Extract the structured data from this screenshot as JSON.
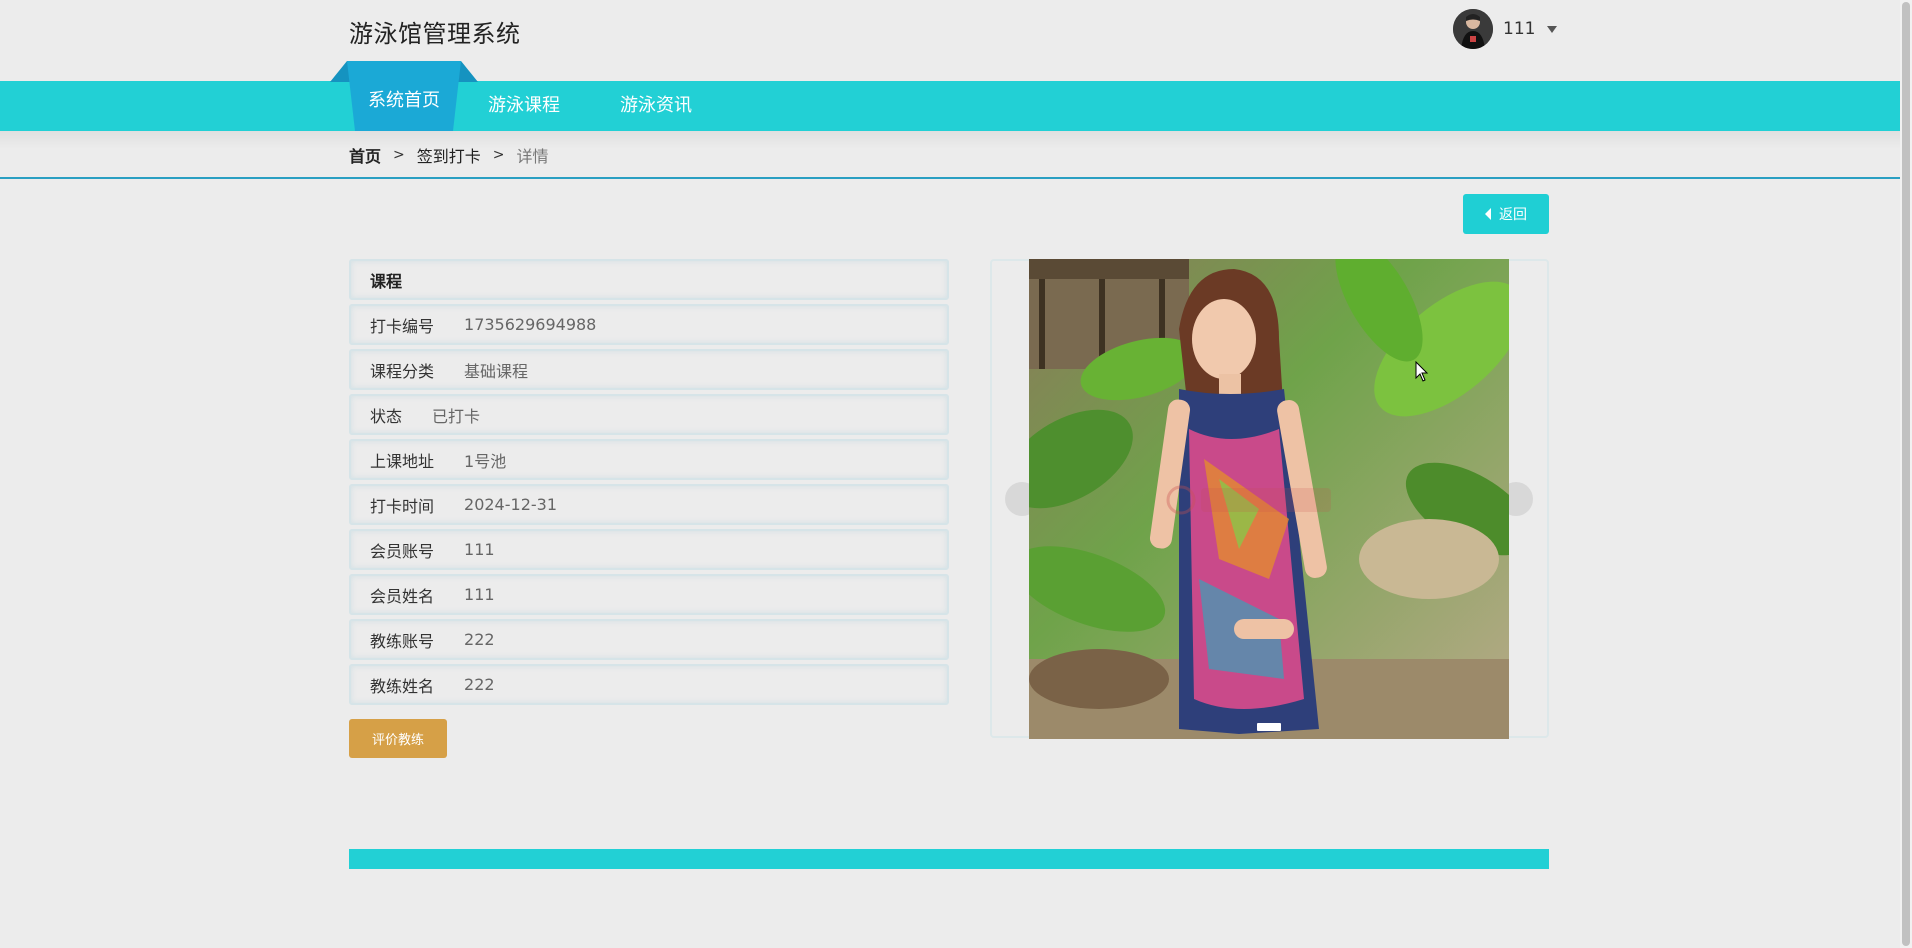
{
  "header": {
    "site_title": "游泳馆管理系统",
    "username": "111"
  },
  "nav": {
    "items": [
      {
        "label": "系统首页",
        "active": true
      },
      {
        "label": "游泳课程",
        "active": false
      },
      {
        "label": "游泳资讯",
        "active": false
      }
    ]
  },
  "breadcrumb": {
    "home": "首页",
    "section": "签到打卡",
    "current": "详情",
    "separator": ">"
  },
  "back_button": {
    "label": "返回"
  },
  "detail": {
    "title": "课程",
    "rows": [
      {
        "label": "打卡编号",
        "value": "1735629694988"
      },
      {
        "label": "课程分类",
        "value": "基础课程"
      },
      {
        "label": "状态",
        "value": "已打卡"
      },
      {
        "label": "上课地址",
        "value": "1号池"
      },
      {
        "label": "打卡时间",
        "value": "2024-12-31"
      },
      {
        "label": "会员账号",
        "value": "111"
      },
      {
        "label": "会员姓名",
        "value": "111"
      },
      {
        "label": "教练账号",
        "value": "222"
      },
      {
        "label": "教练姓名",
        "value": "222"
      }
    ]
  },
  "rate_button": {
    "label": "评价教练"
  },
  "colors": {
    "nav": "#22d0d5",
    "nav_active": "#1ba9d6",
    "back_button": "#1fcfd4",
    "rate_button": "#d6a047",
    "breadcrumb_line": "#2a9fc2"
  }
}
